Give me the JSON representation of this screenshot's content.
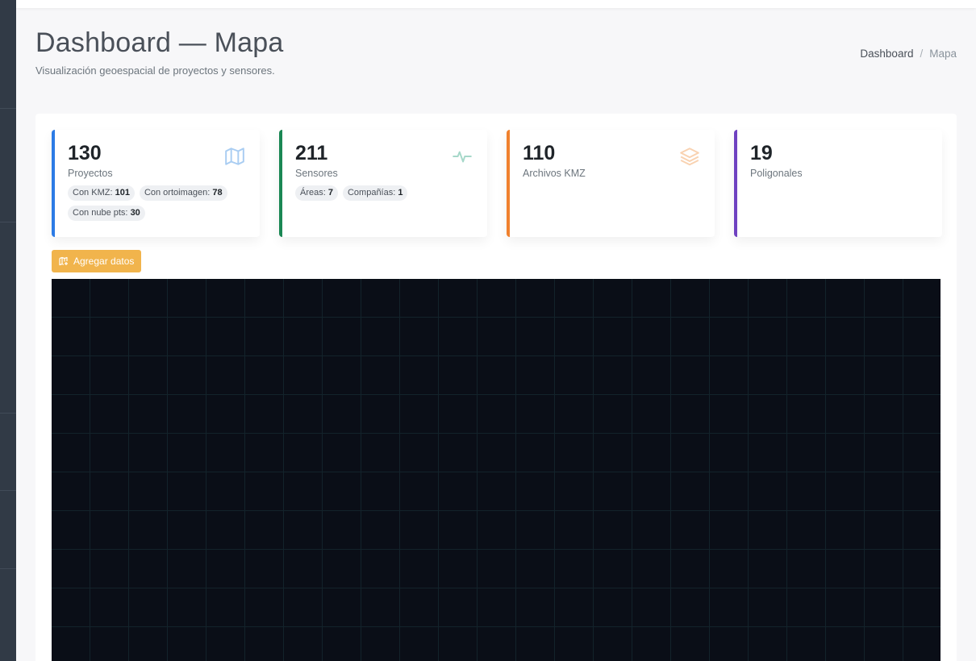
{
  "page": {
    "title": "Dashboard — Mapa",
    "subtitle": "Visualización geoespacial de proyectos y sensores."
  },
  "breadcrumb": {
    "items": [
      "Dashboard",
      "Mapa"
    ],
    "separator": "/"
  },
  "stats": [
    {
      "value": "130",
      "label": "Proyectos",
      "accent": "#2c7be5",
      "icon": "map-icon",
      "chips": [
        {
          "label": "Con KMZ:",
          "value": "101"
        },
        {
          "label": "Con ortoimagen:",
          "value": "78"
        },
        {
          "label": "Con nube pts:",
          "value": "30"
        }
      ]
    },
    {
      "value": "211",
      "label": "Sensores",
      "accent": "#1a8754",
      "icon": "activity-icon",
      "chips": [
        {
          "label": "Áreas:",
          "value": "7"
        },
        {
          "label": "Compañías:",
          "value": "1"
        }
      ]
    },
    {
      "value": "110",
      "label": "Archivos KMZ",
      "accent": "#f0812e",
      "icon": "layers-icon",
      "chips": []
    },
    {
      "value": "19",
      "label": "Poligonales",
      "accent": "#6f42c1",
      "icon": "",
      "chips": []
    }
  ],
  "actions": {
    "add_data_label": "Agregar datos",
    "add_data_icon": "map-add-icon",
    "add_data_color": "#f1b44c"
  },
  "map": {
    "background": "#0a0e17",
    "grid_color": "#13232b"
  }
}
